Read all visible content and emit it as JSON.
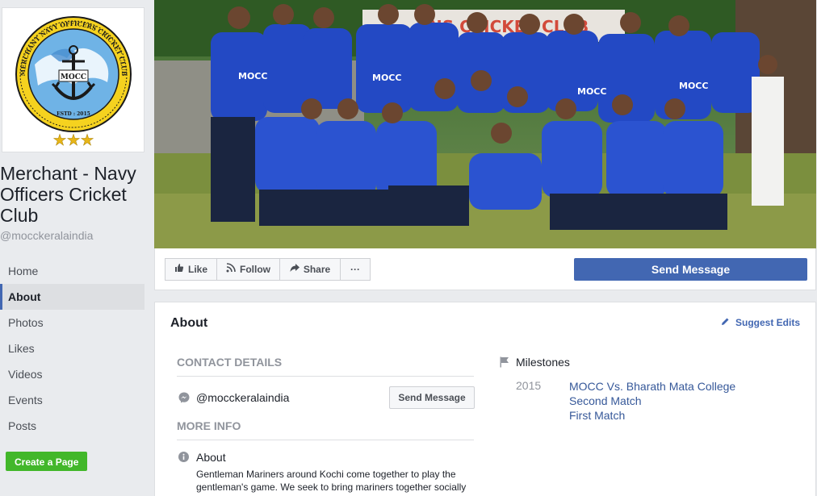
{
  "page": {
    "name": "Merchant - Navy Officers Cricket Club",
    "handle": "@mocckeralaindia"
  },
  "logo": {
    "top_text": "MERCHANT NAVY OFFICERS CRICKET CLUB",
    "center_text": "MOCC",
    "estd": "ESTD : 2015",
    "stars": "★★★"
  },
  "left_nav": {
    "items": [
      "Home",
      "About",
      "Photos",
      "Likes",
      "Videos",
      "Events",
      "Posts"
    ],
    "active": "About"
  },
  "create_page_label": "Create a Page",
  "cover": {
    "banner_text": "...ANS CRICKET CLUB",
    "jersey_text": "MOCC"
  },
  "actions": {
    "like": "Like",
    "follow": "Follow",
    "share": "Share",
    "more": "···",
    "send_message": "Send Message"
  },
  "about": {
    "title": "About",
    "suggest_edits": "Suggest Edits",
    "contact_header": "CONTACT DETAILS",
    "contact_handle": "@mocckeralaindia",
    "send_message": "Send Message",
    "more_info_header": "MORE INFO",
    "about_label": "About",
    "about_text": "Gentleman Mariners around Kochi come together to play the gentleman's game. We seek to bring mariners together socially"
  },
  "milestones": {
    "header": "Milestones",
    "year": "2015",
    "items": [
      "MOCC Vs. Bharath Mata College",
      "Second Match",
      "First Match"
    ]
  },
  "colors": {
    "brand_blue": "#4267b2",
    "link_blue": "#365899",
    "create_green": "#42b72a",
    "jersey_blue": "#2349c4"
  }
}
